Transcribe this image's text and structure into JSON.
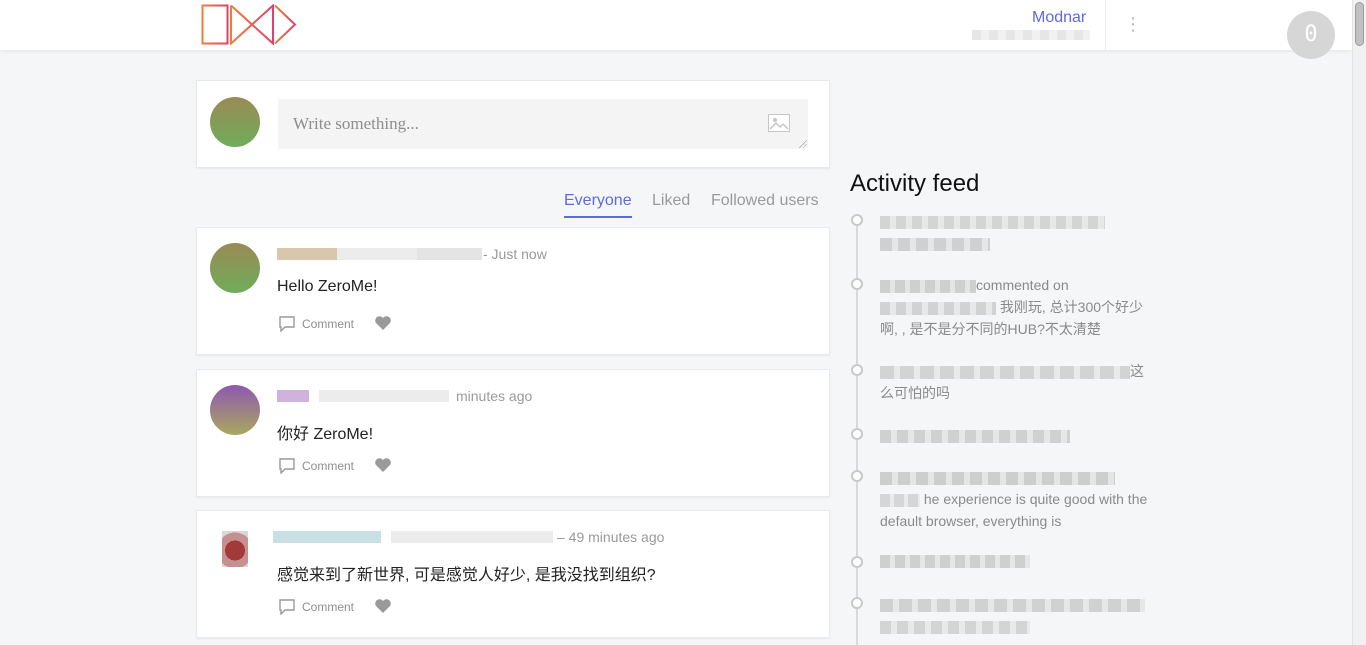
{
  "header": {
    "user_name": "Modnar",
    "notification_count": "0",
    "more_symbol": "⋮"
  },
  "compose": {
    "placeholder": "Write something..."
  },
  "tabs": [
    {
      "label": "Everyone",
      "active": true
    },
    {
      "label": "Liked",
      "active": false
    },
    {
      "label": "Followed users",
      "active": false
    }
  ],
  "posts": [
    {
      "time": "- Just now",
      "body": "Hello ZeroMe!",
      "comment_label": "Comment"
    },
    {
      "time": "minutes ago",
      "body": "你好 ZeroMe!",
      "comment_label": "Comment"
    },
    {
      "time": "– 49 minutes ago",
      "body": "感觉来到了新世界, 可是感觉人好少, 是我没找到组织?",
      "comment_label": "Comment"
    }
  ],
  "activity": {
    "title": "Activity feed",
    "items": [
      {
        "text": ""
      },
      {
        "text_a": "commented on",
        "text_b": "我刚玩, 总计300个好少啊, , 是不是分不同的HUB?不太清楚"
      },
      {
        "text_a": "这",
        "text_b": "么可怕的吗"
      },
      {
        "text": ""
      },
      {
        "text": "he experience is quite good with the default browser, everything is"
      },
      {
        "text": ""
      },
      {
        "text": ""
      }
    ]
  },
  "colors": {
    "accent": "#5d6ae0",
    "logo_orange": "#ef7d3a",
    "logo_pink": "#e0406e"
  }
}
